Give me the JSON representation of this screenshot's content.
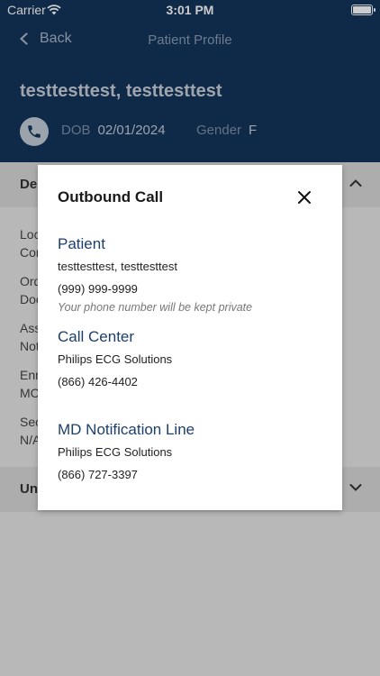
{
  "status_bar": {
    "carrier": "Carrier",
    "time": "3:01 PM"
  },
  "nav": {
    "back_label": "Back",
    "title": "Patient Profile"
  },
  "patient": {
    "name": "testtesttest, testtesttest",
    "dob_label": "DOB",
    "dob": "02/01/2024",
    "gender_label": "Gender",
    "gender": "F"
  },
  "background": {
    "section1_label": "Der",
    "fields": [
      {
        "l1": "Loc",
        "l2": "Cor"
      },
      {
        "l1": "Ord",
        "l2": "Doc"
      },
      {
        "l1": "Ass",
        "l2": "Not"
      },
      {
        "l1": "Enr",
        "l2": "MC"
      },
      {
        "l1": "Sec",
        "l2": "N/A"
      }
    ],
    "section2_label": "Unr"
  },
  "modal": {
    "title": "Outbound Call",
    "patient_heading": "Patient",
    "patient_name": "testtesttest, testtesttest",
    "patient_phone": "(999) 999-9999",
    "privacy_note": "Your phone number will be kept private",
    "call_center_heading": "Call Center",
    "call_center_name": "Philips ECG Solutions",
    "call_center_phone": "(866) 426-4402",
    "md_heading": "MD Notification Line",
    "md_name": "Philips ECG Solutions",
    "md_phone": "(866) 727-3397"
  },
  "colors": {
    "header_bg": "#12355b",
    "heading_blue": "#1d3f6b"
  }
}
